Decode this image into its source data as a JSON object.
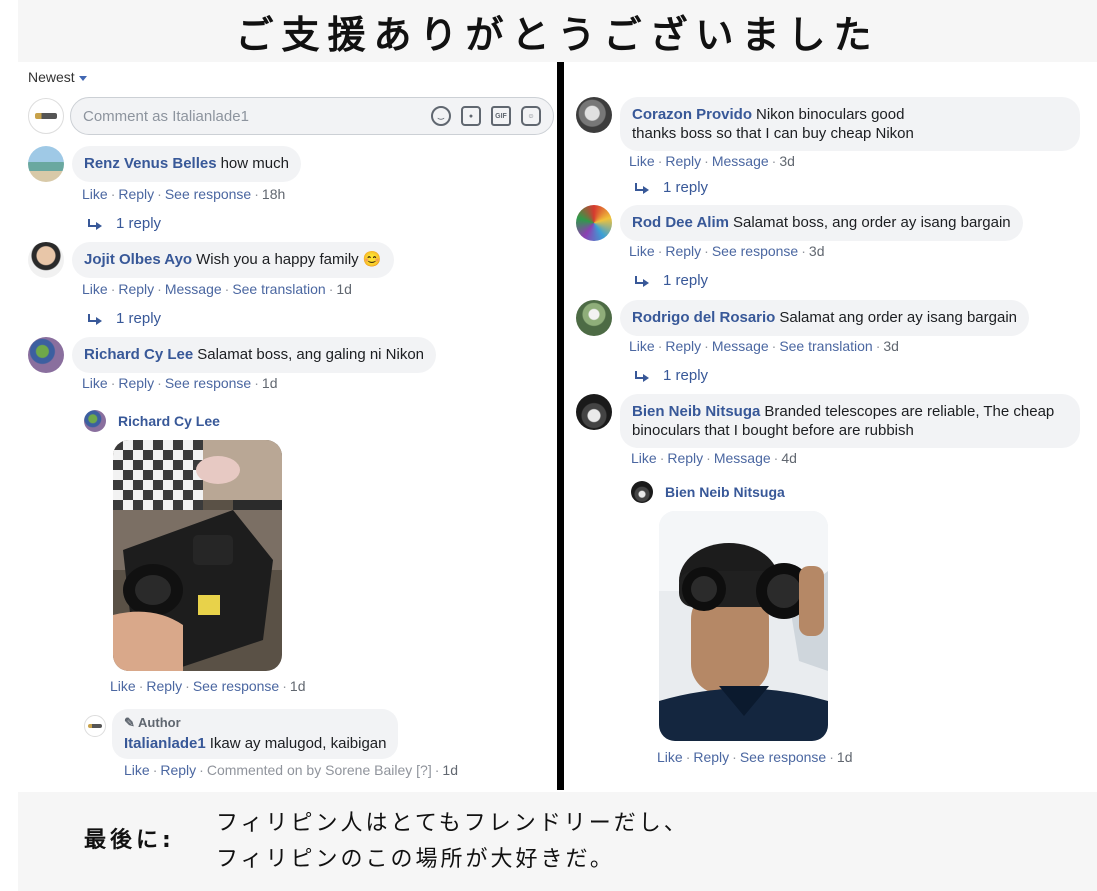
{
  "header": {
    "title": "ご支援ありがとうございました"
  },
  "sort": {
    "label": "Newest"
  },
  "compose": {
    "placeholder": "Comment as Italianlade1"
  },
  "actions": {
    "like": "Like",
    "reply": "Reply",
    "see_response": "See response",
    "message": "Message",
    "see_translation": "See translation",
    "one_reply": "1 reply"
  },
  "left": {
    "c1": {
      "name": "Renz Venus Belles",
      "text": "how much",
      "time": "18h"
    },
    "c2": {
      "name": "Jojit Olbes Ayo",
      "text": "Wish you a happy family 😊",
      "time": "1d"
    },
    "c3": {
      "name": "Richard Cy Lee",
      "text": "Salamat boss, ang galing ni Nikon",
      "time": "1d"
    },
    "c3_sub": {
      "name": "Richard Cy Lee",
      "time": "1d"
    },
    "author": {
      "badge": "Author",
      "name": "Italianlade1",
      "text": "Ikaw ay malugod, kaibigan",
      "commented_on": "Commented on by Sorene Bailey",
      "q": "[?]",
      "time": "1d"
    }
  },
  "right": {
    "c1": {
      "name": "Corazon Provido",
      "text": "Nikon binoculars good",
      "text2": "thanks boss so that I can buy cheap Nikon",
      "time": "3d"
    },
    "c2": {
      "name": "Rod Dee Alim",
      "text": "Salamat boss, ang order ay isang bargain",
      "time": "3d"
    },
    "c3": {
      "name": "Rodrigo del Rosario",
      "text": "Salamat ang order ay isang bargain",
      "time": "3d"
    },
    "c4": {
      "name": "Bien Neib Nitsuga",
      "text": "Branded telescopes are reliable, The cheap",
      "text2": "binoculars that I bought before are rubbish",
      "time": "4d"
    },
    "c4_sub": {
      "name": "Bien Neib Nitsuga",
      "time": "1d"
    }
  },
  "footer": {
    "label": "最後に:",
    "line1": "フィリピン人はとてもフレンドリーだし、",
    "line2": "フィリピンのこの場所が大好きだ。"
  },
  "icons": [
    "smile-icon",
    "camera-icon",
    "gif-icon",
    "sticker-icon",
    "reply-arrow-icon",
    "pencil-icon",
    "caret-down-icon"
  ],
  "colors": {
    "link": "#385898",
    "bubble": "#f2f3f5",
    "divider": "#000000"
  }
}
